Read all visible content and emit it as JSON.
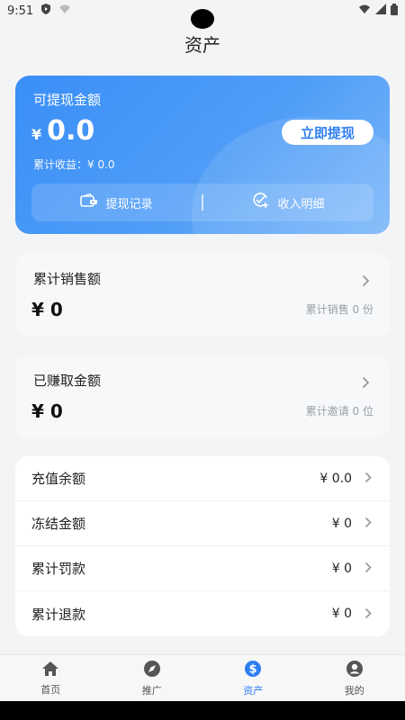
{
  "status_bar": {
    "time": "9:51"
  },
  "header": {
    "title": "资产"
  },
  "wallet": {
    "label": "可提现金额",
    "currency": "¥",
    "amount": "0.0",
    "withdraw_button": "立即提现",
    "cumulative_income": "累计收益：¥ 0.0",
    "actions": [
      {
        "label": "提现记录",
        "icon": "wallet-record-icon"
      },
      {
        "label": "收入明细",
        "icon": "income-check-icon"
      }
    ]
  },
  "sales_card": {
    "title": "累计销售额",
    "value": "¥ 0",
    "sub": "累计销售 0 份"
  },
  "earned_card": {
    "title": "已赚取金额",
    "value": "¥ 0",
    "sub": "累计邀请 0 位"
  },
  "balances": [
    {
      "label": "充值余额",
      "value": "¥ 0.0"
    },
    {
      "label": "冻结金额",
      "value": "¥ 0"
    },
    {
      "label": "累计罚款",
      "value": "¥ 0"
    },
    {
      "label": "累计退款",
      "value": "¥ 0"
    }
  ],
  "tabs": [
    {
      "label": "首页",
      "icon": "home-icon",
      "active": false
    },
    {
      "label": "推广",
      "icon": "compass-icon",
      "active": false
    },
    {
      "label": "资产",
      "icon": "dollar-icon",
      "active": true
    },
    {
      "label": "我的",
      "icon": "user-icon",
      "active": false
    }
  ],
  "colors": {
    "accent": "#2f7ef1",
    "card_gradient_start": "#3a8ef6",
    "card_gradient_end": "#7cb8fa"
  }
}
